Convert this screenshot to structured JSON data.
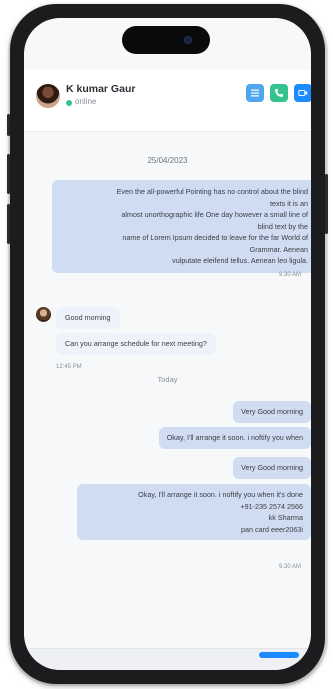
{
  "contact": {
    "name": "K kumar Gaur",
    "status": "online"
  },
  "header_actions": [
    {
      "icon": "list-icon",
      "color": "#50a5f1"
    },
    {
      "icon": "phone-icon",
      "color": "#34c38f"
    },
    {
      "icon": "video-icon",
      "color": "#1a8cff"
    }
  ],
  "chat": {
    "date": "25/04/2023",
    "long_message": {
      "lines": [
        "Even the all-powerful Pointing has no control about the blind",
        "texts it is an",
        "almost unorthographic life One day however a small line of",
        "blind text by the",
        "name of Lorem Ipsum decided to leave for the far World of",
        "Grammar. Aenean",
        "vulputate eleifend tellus. Aenean leo ligula."
      ],
      "time": "9.30 AM"
    },
    "incoming": [
      {
        "text": "Good morning"
      },
      {
        "text": "Can you arrange schedule for next meeting?"
      }
    ],
    "incoming_time": "12:45 PM",
    "separator": "Today",
    "outgoing": [
      {
        "text": "Very Good morning"
      },
      {
        "text": "Okay, I'll arrange it soon. i noftify you when"
      },
      {
        "text": "Very Good morning"
      }
    ],
    "final_message": {
      "lines": [
        "Okay, I'll arrange it soon. i noftify you when it's done",
        "+91-235 2574 2566",
        "kk Sharma",
        "pan card eeer2063i"
      ],
      "time": "9.30 AM"
    }
  },
  "colors": {
    "accent": "#1a8cff",
    "online": "#34c38f",
    "outgoing_bubble": "#cfdcf1",
    "incoming_bubble": "#eef3fb"
  }
}
